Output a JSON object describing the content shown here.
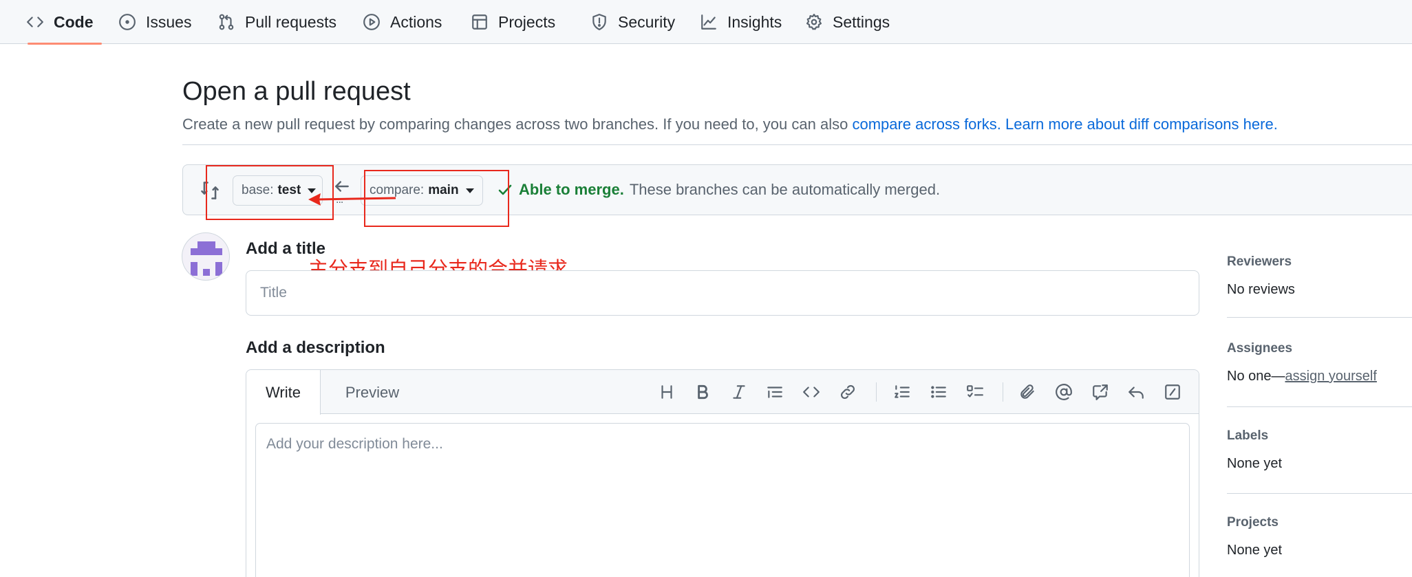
{
  "nav": {
    "tabs": [
      {
        "label": "Code",
        "icon": "code-icon",
        "active": true
      },
      {
        "label": "Issues",
        "icon": "issue-icon"
      },
      {
        "label": "Pull requests",
        "icon": "pull-request-icon"
      },
      {
        "label": "Actions",
        "icon": "play-icon"
      },
      {
        "label": "Projects",
        "icon": "table-icon"
      },
      {
        "label": "Security",
        "icon": "shield-icon"
      },
      {
        "label": "Insights",
        "icon": "graph-icon"
      },
      {
        "label": "Settings",
        "icon": "gear-icon"
      }
    ]
  },
  "header": {
    "title": "Open a pull request",
    "subtitle_text": "Create a new pull request by comparing changes across two branches. If you need to, you can also ",
    "link_forks": "compare across forks.",
    "link_learn": "Learn more about diff comparisons here."
  },
  "compare": {
    "base_prefix": "base:",
    "base_branch": "test",
    "compare_prefix": "compare:",
    "compare_branch": "main",
    "dots": "...",
    "status_ok": "Able to merge.",
    "status_text": "These branches can be automatically merged."
  },
  "annotation": {
    "note": "主分支到自己分支的合并请求",
    "color": "#e8281c"
  },
  "form": {
    "title_label": "Add a title",
    "title_placeholder": "Title",
    "desc_label": "Add a description",
    "tab_write": "Write",
    "tab_preview": "Preview",
    "desc_placeholder": "Add your description here...",
    "toolbar_icons": [
      "heading-icon",
      "bold-icon",
      "italic-icon",
      "quote-icon",
      "code-icon",
      "link-icon",
      "ordered-list-icon",
      "unordered-list-icon",
      "task-list-icon",
      "attach-icon",
      "mention-icon",
      "cross-reference-icon",
      "reply-icon",
      "slash-command-icon"
    ]
  },
  "sidebar": {
    "reviewers": {
      "heading": "Reviewers",
      "value": "No reviews"
    },
    "assignees": {
      "heading": "Assignees",
      "value_prefix": "No one—",
      "link": "assign yourself"
    },
    "labels": {
      "heading": "Labels",
      "value": "None yet"
    },
    "projects": {
      "heading": "Projects",
      "value": "None yet"
    }
  },
  "colors": {
    "accent_underline": "#fd8c73",
    "link": "#0969da",
    "success": "#1a7f37",
    "avatar": "#8c6fd6"
  }
}
